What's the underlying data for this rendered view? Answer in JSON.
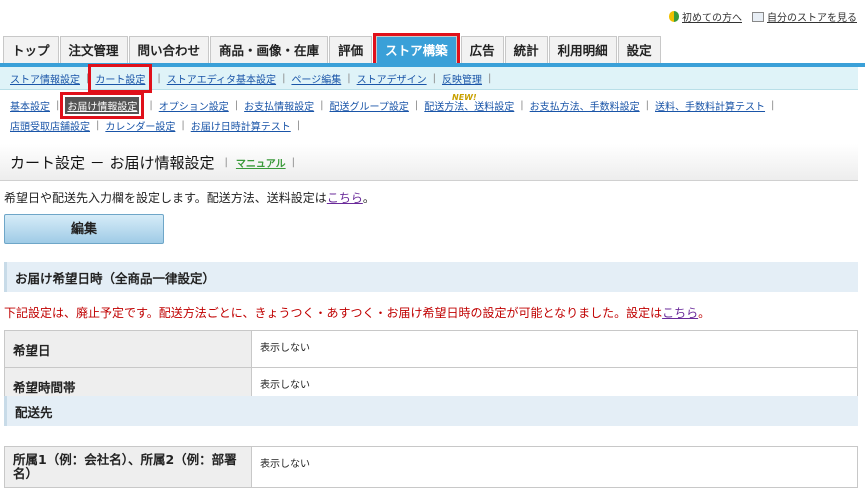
{
  "toplinks": {
    "beginners": "初めての方へ",
    "view_store": "自分のストアを見る"
  },
  "main_nav": [
    "トップ",
    "注文管理",
    "問い合わせ",
    "商品・画像・在庫",
    "評価",
    "ストア構築",
    "広告",
    "統計",
    "利用明細",
    "設定"
  ],
  "main_nav_active": "ストア構築",
  "sub_nav_1": [
    "ストア情報設定",
    "カート設定",
    "ストアエディタ基本設定",
    "ページ編集",
    "ストアデザイン",
    "反映管理"
  ],
  "sub_nav_1_active": "カート設定",
  "sub_nav_2_row1": [
    "基本設定",
    "お届け情報設定",
    "オプション設定",
    "お支払情報設定",
    "配送グループ設定",
    "配送方法、送料設定",
    "お支払方法、手数料設定",
    "送料、手数料計算テスト"
  ],
  "sub_nav_2_row2": [
    "店頭受取店舗設定",
    "カレンダー設定",
    "お届け日時計算テスト"
  ],
  "sub_nav_2_active": "お届け情報設定",
  "new_badge": "NEW!",
  "page": {
    "title": "カート設定 － お届け情報設定",
    "manual": "マニュアル",
    "description_prefix": "希望日や配送先入力欄を設定します。配送方法、送料設定は",
    "description_link": "こちら",
    "description_suffix": "。",
    "edit_button": "編集"
  },
  "section_delivery_date": {
    "title": "お届け希望日時（全商品一律設定）",
    "warning_prefix": "下記設定は、廃止予定です。配送方法ごとに、きょうつく・あすつく・お届け希望日時の設定が可能となりました。設定は",
    "warning_link": "こちら",
    "warning_suffix": "。",
    "rows": [
      {
        "label": "希望日",
        "value": "表示しない"
      },
      {
        "label": "希望時間帯",
        "value": "表示しない"
      }
    ]
  },
  "section_destination": {
    "title": "配送先",
    "rows": [
      {
        "label": "所属1（例：会社名）、所属2（例：部署名）",
        "value": "表示しない"
      }
    ]
  },
  "colors": {
    "accent": "#3aa0d8",
    "highlight": "#e0101a",
    "warning": "#c00000"
  }
}
